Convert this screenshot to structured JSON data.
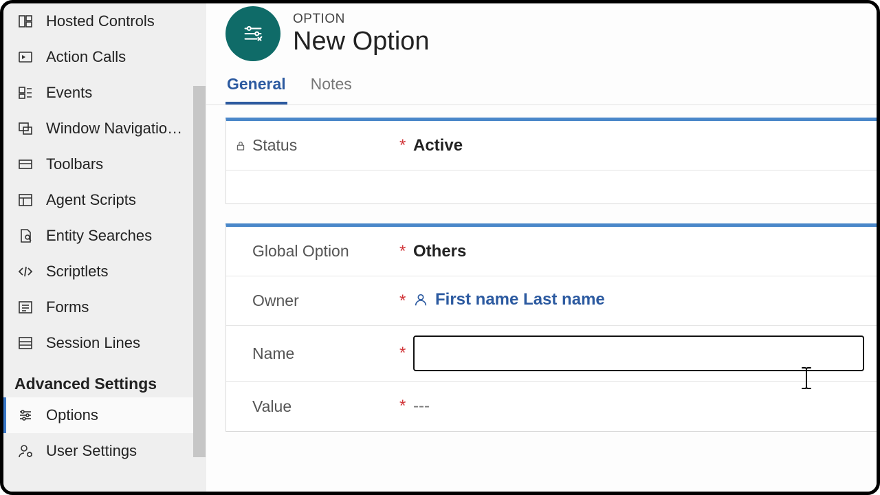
{
  "sidebar": {
    "items": [
      {
        "label": "Hosted Controls",
        "icon": "hosted-controls-icon"
      },
      {
        "label": "Action Calls",
        "icon": "action-calls-icon"
      },
      {
        "label": "Events",
        "icon": "events-icon"
      },
      {
        "label": "Window Navigatio…",
        "icon": "window-nav-icon"
      },
      {
        "label": "Toolbars",
        "icon": "toolbars-icon"
      },
      {
        "label": "Agent Scripts",
        "icon": "agent-scripts-icon"
      },
      {
        "label": "Entity Searches",
        "icon": "entity-search-icon"
      },
      {
        "label": "Scriptlets",
        "icon": "scriptlets-icon"
      },
      {
        "label": "Forms",
        "icon": "forms-icon"
      },
      {
        "label": "Session Lines",
        "icon": "session-lines-icon"
      }
    ],
    "section_header": "Advanced Settings",
    "advanced": [
      {
        "label": "Options",
        "icon": "options-icon",
        "active": true
      },
      {
        "label": "User Settings",
        "icon": "user-settings-icon",
        "active": false
      }
    ]
  },
  "header": {
    "entity": "OPTION",
    "title": "New Option",
    "icon": "option-entity-icon"
  },
  "tabs": [
    {
      "label": "General",
      "active": true
    },
    {
      "label": "Notes",
      "active": false
    }
  ],
  "form": {
    "status": {
      "label": "Status",
      "required": true,
      "locked": true,
      "value": "Active"
    },
    "global_option": {
      "label": "Global Option",
      "required": true,
      "value": "Others"
    },
    "owner": {
      "label": "Owner",
      "required": true,
      "value": "First name Last name"
    },
    "name": {
      "label": "Name",
      "required": true,
      "value": ""
    },
    "value": {
      "label": "Value",
      "required": true,
      "value": "---"
    }
  },
  "required_marker": "*",
  "colors": {
    "accent_tab": "#2c5aa0",
    "panel_bar": "#4a87c9",
    "entity_circle": "#0f6b68",
    "required": "#d13438"
  }
}
